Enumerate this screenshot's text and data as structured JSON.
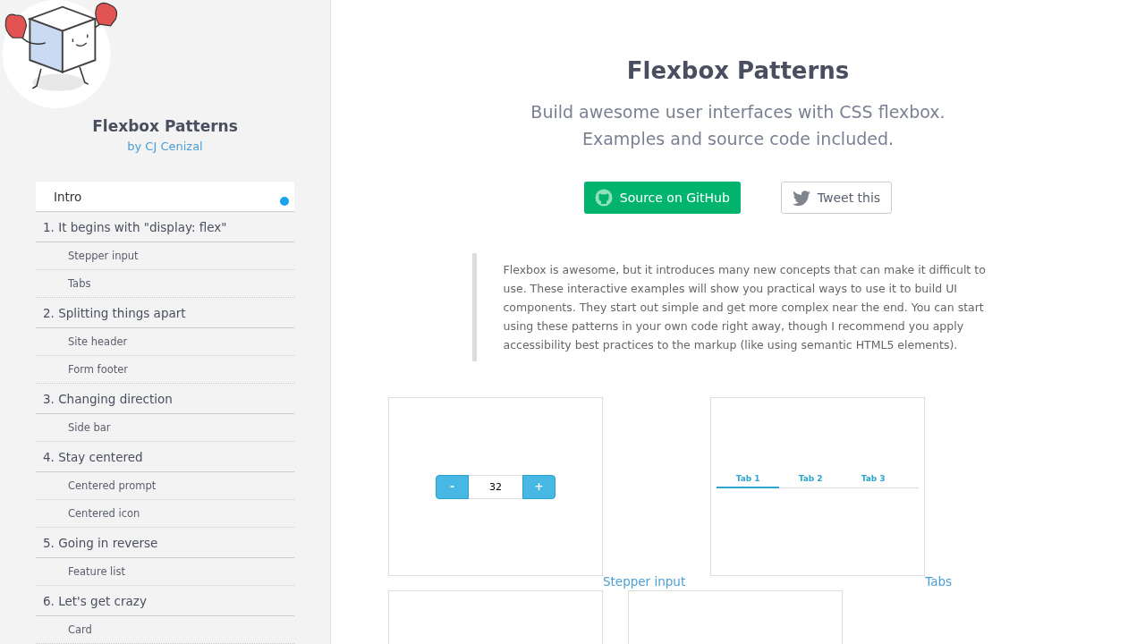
{
  "sidebar": {
    "title": "Flexbox Patterns",
    "author_link": "by CJ Cenizal",
    "nav": [
      {
        "label": "Intro",
        "selected": true
      },
      {
        "label": "1. It begins with \"display: flex\"",
        "selected": false,
        "children": [
          {
            "label": "Stepper input"
          },
          {
            "label": "Tabs"
          }
        ]
      },
      {
        "label": "2. Splitting things apart",
        "selected": false,
        "children": [
          {
            "label": "Site header"
          },
          {
            "label": "Form footer"
          }
        ]
      },
      {
        "label": "3. Changing direction",
        "selected": false,
        "children": [
          {
            "label": "Side bar"
          }
        ]
      },
      {
        "label": "4. Stay centered",
        "selected": false,
        "children": [
          {
            "label": "Centered prompt"
          },
          {
            "label": "Centered icon"
          }
        ]
      },
      {
        "label": "5. Going in reverse",
        "selected": false,
        "children": [
          {
            "label": "Feature list"
          }
        ]
      },
      {
        "label": "6. Let's get crazy",
        "selected": false,
        "children": [
          {
            "label": "Card"
          }
        ]
      }
    ]
  },
  "main": {
    "title": "Flexbox Patterns",
    "subtitle_lines": [
      "Build awesome user interfaces with CSS flexbox.",
      "Examples and source code included."
    ],
    "buttons": [
      {
        "kind": "github",
        "label": "Source on GitHub"
      },
      {
        "kind": "tweet",
        "label": "Tweet this"
      }
    ],
    "intro": "Flexbox is awesome, but it introduces many new concepts that can make it difficult to use. These interactive examples will show you practical ways to use it to build UI components. They start out simple and get more complex near the end. You can start using these patterns in your own code right away, though I recommend you apply accessibility best practices to the markup (like using semantic HTML5 elements).",
    "examples": [
      {
        "kind": "stepper",
        "label": "Stepper input",
        "minus": "-",
        "value": "32",
        "plus": "+"
      },
      {
        "kind": "tabs",
        "label": "Tabs",
        "tabs": [
          {
            "label": "Tab 1",
            "selected": true
          },
          {
            "label": "Tab 2",
            "selected": false
          },
          {
            "label": "Tab 3",
            "selected": false
          }
        ]
      },
      {
        "kind": "blank"
      },
      {
        "kind": "blank"
      }
    ]
  }
}
